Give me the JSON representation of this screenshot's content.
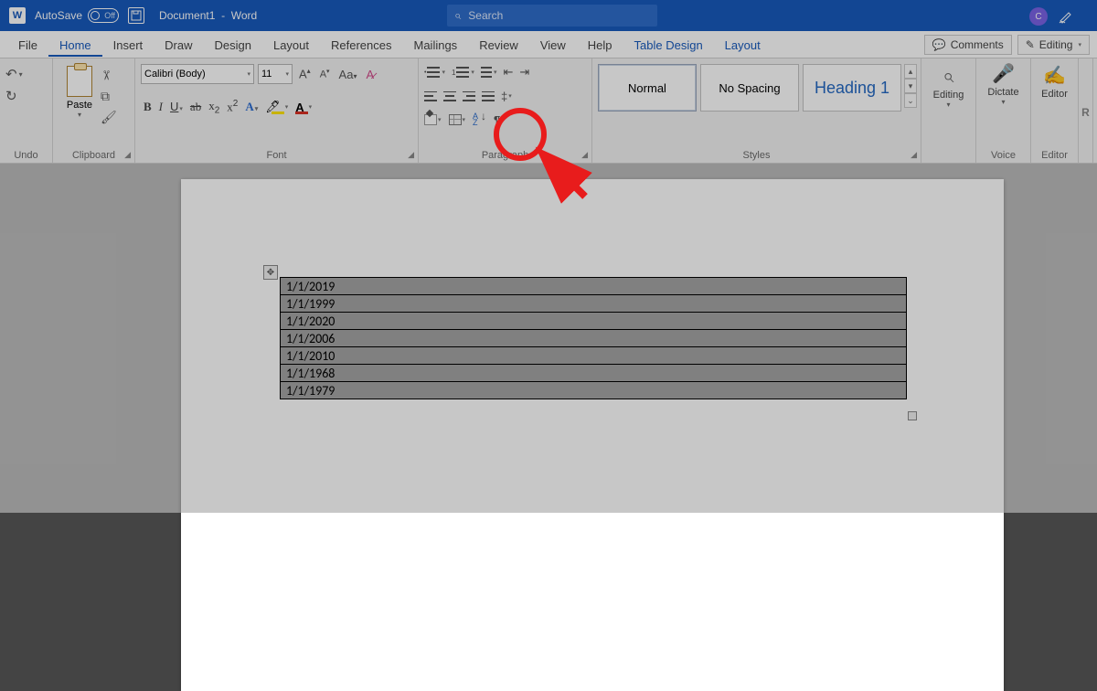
{
  "titlebar": {
    "autosave_label": "AutoSave",
    "autosave_state": "Off",
    "doc_title": "Document1  -  Word",
    "search_placeholder": "Search",
    "user_initial": "C"
  },
  "menu": {
    "tabs": [
      "File",
      "Home",
      "Insert",
      "Draw",
      "Design",
      "Layout",
      "References",
      "Mailings",
      "Review",
      "View",
      "Help",
      "Table Design",
      "Layout"
    ],
    "active": "Home",
    "contextual": [
      "Table Design",
      "Layout"
    ],
    "comments_label": "Comments",
    "editing_label": "Editing"
  },
  "ribbon": {
    "undo_label": "Undo",
    "clipboard_label": "Clipboard",
    "paste_label": "Paste",
    "font_label": "Font",
    "font_name": "Calibri (Body)",
    "font_size": "11",
    "paragraph_label": "Paragraph",
    "styles_label": "Styles",
    "styles": [
      {
        "name": "Normal"
      },
      {
        "name": "No Spacing"
      },
      {
        "name": "Heading 1"
      }
    ],
    "editing_group_label": "Editing",
    "voice_label": "Voice",
    "dictate_label": "Dictate",
    "editor_label": "Editor",
    "editor_group_label": "Editor",
    "reuse_hint": "R"
  },
  "table": {
    "rows": [
      "1/1/2019",
      "1/1/1999",
      "1/1/2020",
      "1/1/2006",
      "1/1/2010",
      "1/1/1968",
      "1/1/1979"
    ]
  }
}
